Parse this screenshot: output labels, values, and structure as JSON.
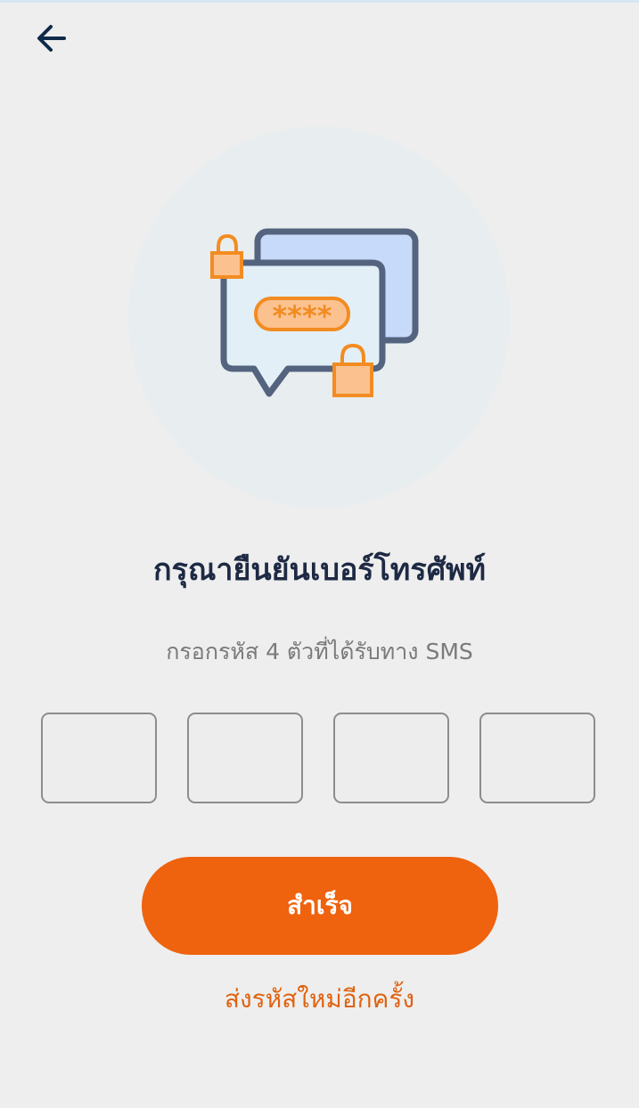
{
  "header": {
    "back_icon": "arrow-left-icon",
    "back_icon_color": "#0f2a4a"
  },
  "hero": {
    "icon": "chat-bubbles-lock-password-icon",
    "password_mask": "****",
    "circle_color": "#e8edef",
    "accent_orange": "#f28c22",
    "outline_color": "#54637e"
  },
  "title": "กรุณายืนยันเบอร์โทรศัพท์",
  "subtitle": "กรอกรหัส 4 ตัวที่ได้รับทาง SMS",
  "otp": {
    "digits": [
      "",
      "",
      "",
      ""
    ]
  },
  "submit_label": "สำเร็จ",
  "resend_label": "ส่งรหัสใหม่อีกครั้ง",
  "colors": {
    "primary": "#ef620e",
    "background": "#eeeeee",
    "title_text": "#1e2a44"
  }
}
